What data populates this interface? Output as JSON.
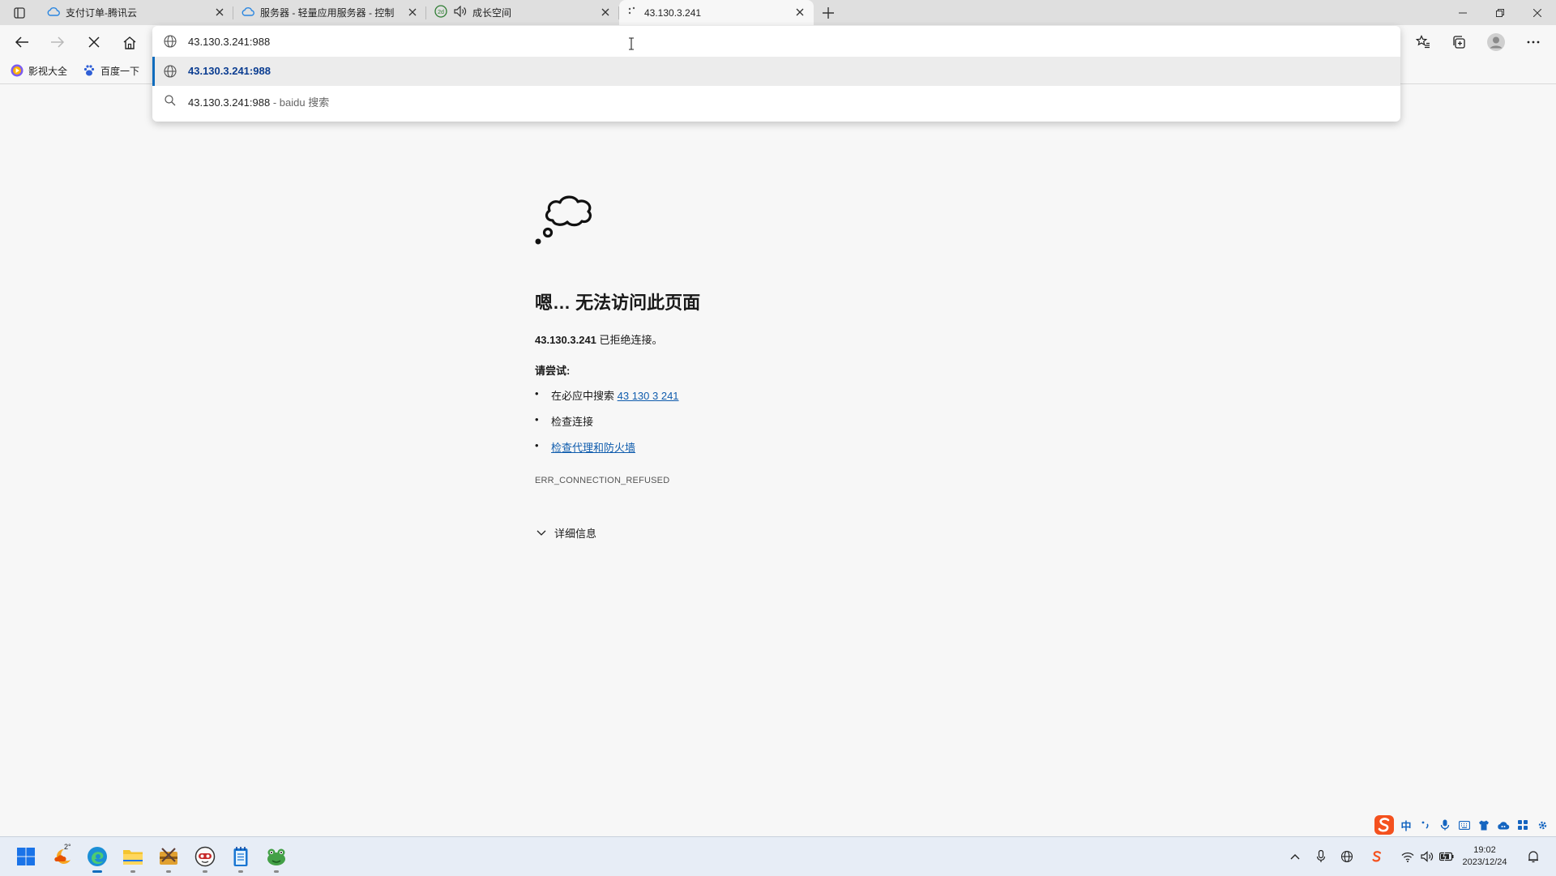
{
  "tabs": [
    {
      "title": "支付订单-腾讯云",
      "icon": "cloud-icon"
    },
    {
      "title": "服务器 - 轻量应用服务器 - 控制",
      "icon": "cloud-icon"
    },
    {
      "title": "成长空间",
      "icon": "audio-speaker-icon"
    },
    {
      "title": "43.130.3.241",
      "icon": "loading-spinner-icon"
    }
  ],
  "favorites": [
    {
      "label": "影视大全"
    },
    {
      "label": "百度一下"
    }
  ],
  "omnibox": {
    "value": "43.130.3.241:988",
    "suggestions": [
      {
        "bold": "43.130.3.241:988",
        "suffix": ""
      },
      {
        "bold": "43.130.3.241:988",
        "suffix": " - baidu 搜索"
      }
    ]
  },
  "error": {
    "title": "嗯… 无法访问此页面",
    "host": "43.130.3.241",
    "host_suffix": " 已拒绝连接。",
    "try_label": "请尝试:",
    "items": [
      {
        "prefix": "在必应中搜索 ",
        "link": "43 130 3 241"
      },
      {
        "text": "检查连接"
      },
      {
        "link": "检查代理和防火墙"
      }
    ],
    "code": "ERR_CONNECTION_REFUSED",
    "details": "详细信息"
  },
  "ime": {
    "lang": "中"
  },
  "taskbar": {
    "weather": "2°",
    "time": "19:02",
    "date": "2023/12/24"
  },
  "colors": {
    "accent": "#0f6cbd",
    "link": "#0f5cad",
    "ime": "#1565c0"
  }
}
